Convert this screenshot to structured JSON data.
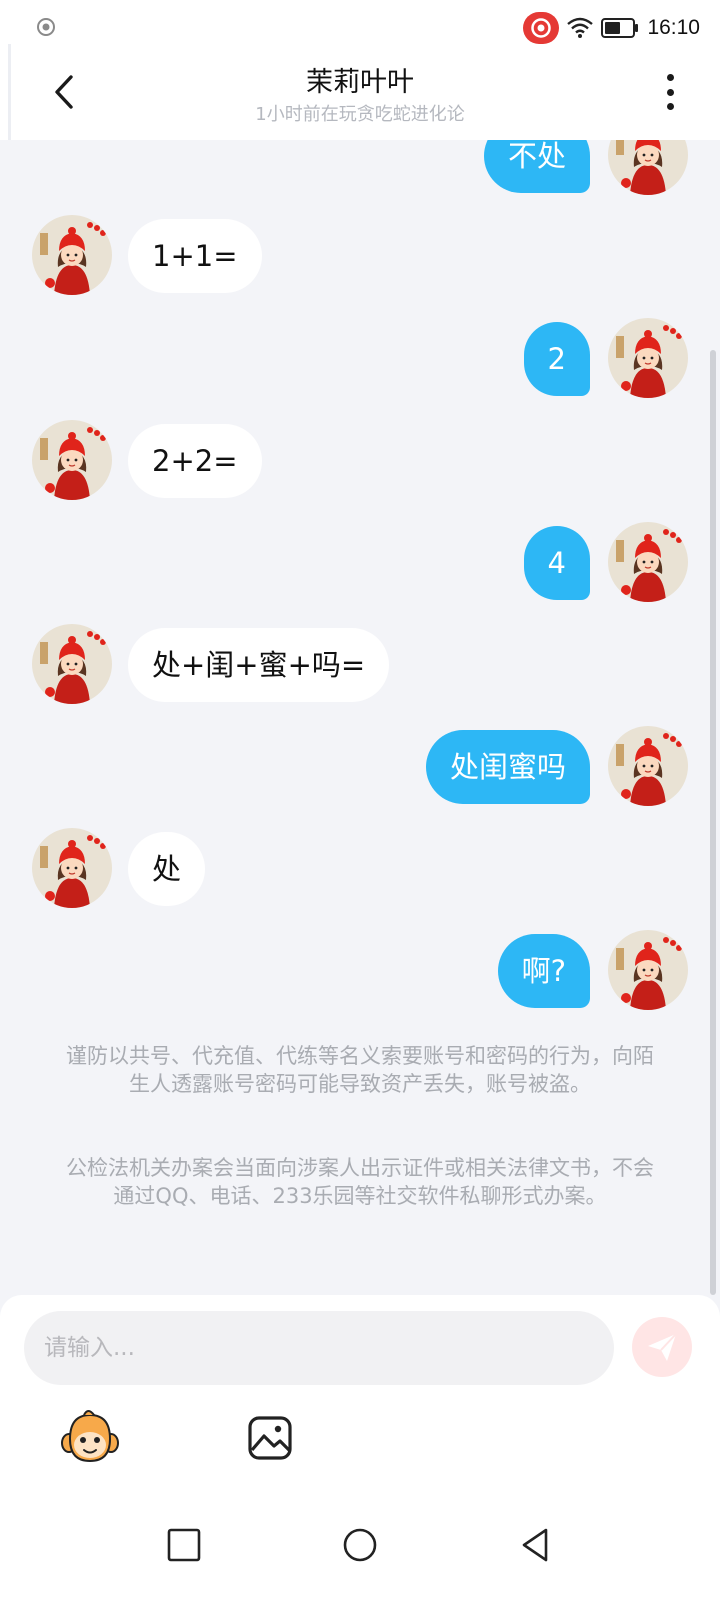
{
  "status_bar": {
    "time": "16:10",
    "icons": [
      "location-icon",
      "screen-record-icon",
      "wifi-icon",
      "battery-icon"
    ]
  },
  "header": {
    "title": "茉莉叶叶",
    "subtitle": "1小时前在玩贪吃蛇进化论",
    "icons": [
      "back-icon",
      "more-icon"
    ]
  },
  "chat": {
    "messages": [
      {
        "side": "right",
        "text": "不处"
      },
      {
        "side": "left",
        "text": "1+1="
      },
      {
        "side": "right",
        "text": "2"
      },
      {
        "side": "left",
        "text": "2+2="
      },
      {
        "side": "right",
        "text": "4"
      },
      {
        "side": "left",
        "text": "处+闺+蜜+吗="
      },
      {
        "side": "right",
        "text": "处闺蜜吗"
      },
      {
        "side": "left",
        "text": "处"
      },
      {
        "side": "right",
        "text": "啊?"
      }
    ],
    "notice_1": "谨防以共号、代充值、代练等名义索要账号和密码的行为，向陌生人透露账号密码可能导致资产丢失，账号被盗。",
    "notice_2": "公检法机关办案会当面向涉案人出示证件或相关法律文书，不会通过QQ、电话、233乐园等社交软件私聊形式办案。"
  },
  "composer": {
    "placeholder": "请输入...",
    "value": "",
    "icons": [
      "send-icon",
      "emoji-icon",
      "image-icon"
    ]
  },
  "colors": {
    "accent": "#2db7f5",
    "background": "#f3f4f8",
    "send_disabled": "#ffe5e5",
    "avatar_hat": "#e0241b"
  },
  "nav": {
    "icons": [
      "recents-icon",
      "home-icon",
      "back-nav-icon"
    ]
  }
}
